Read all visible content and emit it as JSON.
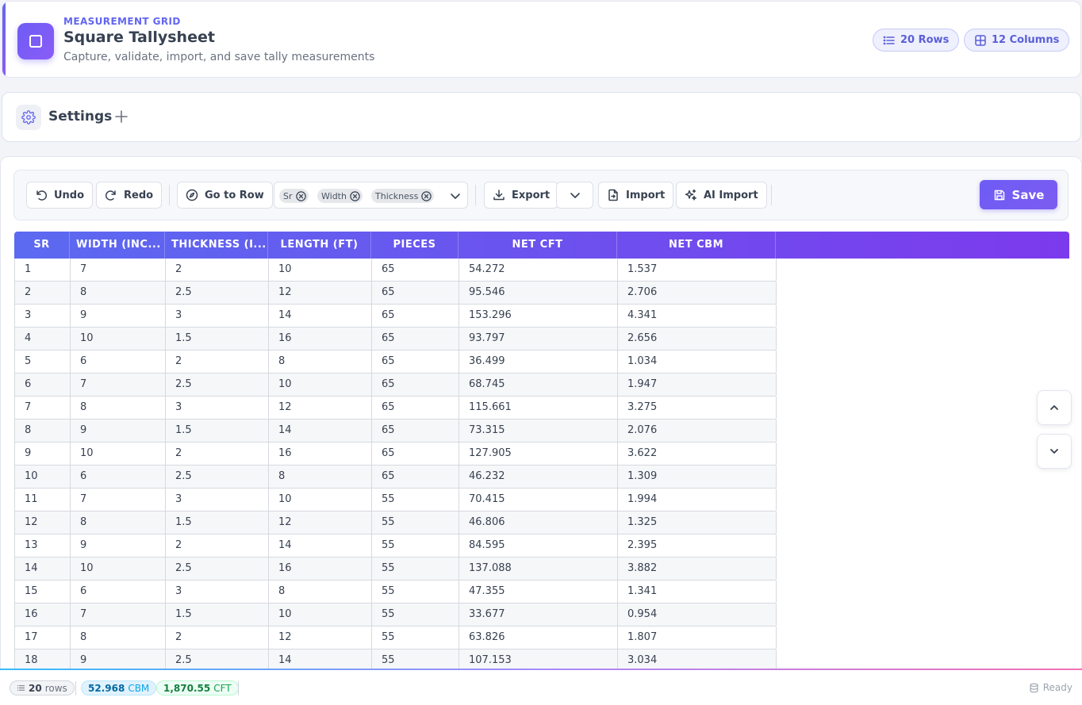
{
  "header": {
    "eyebrow": "MEASUREMENT GRID",
    "title": "Square Tallysheet",
    "subtitle": "Capture, validate, import, and save tally measurements",
    "rows_chip": "20 Rows",
    "columns_chip": "12 Columns",
    "accent_color": "#6366f1"
  },
  "settings": {
    "label": "Settings"
  },
  "toolbar": {
    "undo": "Undo",
    "redo": "Redo",
    "go_to_row": "Go to Row",
    "column_tags": [
      "Sr",
      "Width",
      "Thickness"
    ],
    "export": "Export",
    "import": "Import",
    "ai_import": "AI Import",
    "save": "Save"
  },
  "table": {
    "columns": [
      "SR",
      "WIDTH (INC...",
      "THICKNESS (I...",
      "LENGTH (FT)",
      "PIECES",
      "NET CFT",
      "NET CBM"
    ],
    "rows": [
      [
        "1",
        "7",
        "2",
        "10",
        "65",
        "54.272",
        "1.537"
      ],
      [
        "2",
        "8",
        "2.5",
        "12",
        "65",
        "95.546",
        "2.706"
      ],
      [
        "3",
        "9",
        "3",
        "14",
        "65",
        "153.296",
        "4.341"
      ],
      [
        "4",
        "10",
        "1.5",
        "16",
        "65",
        "93.797",
        "2.656"
      ],
      [
        "5",
        "6",
        "2",
        "8",
        "65",
        "36.499",
        "1.034"
      ],
      [
        "6",
        "7",
        "2.5",
        "10",
        "65",
        "68.745",
        "1.947"
      ],
      [
        "7",
        "8",
        "3",
        "12",
        "65",
        "115.661",
        "3.275"
      ],
      [
        "8",
        "9",
        "1.5",
        "14",
        "65",
        "73.315",
        "2.076"
      ],
      [
        "9",
        "10",
        "2",
        "16",
        "65",
        "127.905",
        "3.622"
      ],
      [
        "10",
        "6",
        "2.5",
        "8",
        "65",
        "46.232",
        "1.309"
      ],
      [
        "11",
        "7",
        "3",
        "10",
        "55",
        "70.415",
        "1.994"
      ],
      [
        "12",
        "8",
        "1.5",
        "12",
        "55",
        "46.806",
        "1.325"
      ],
      [
        "13",
        "9",
        "2",
        "14",
        "55",
        "84.595",
        "2.395"
      ],
      [
        "14",
        "10",
        "2.5",
        "16",
        "55",
        "137.088",
        "3.882"
      ],
      [
        "15",
        "6",
        "3",
        "8",
        "55",
        "47.355",
        "1.341"
      ],
      [
        "16",
        "7",
        "1.5",
        "10",
        "55",
        "33.677",
        "0.954"
      ],
      [
        "17",
        "8",
        "2",
        "12",
        "55",
        "63.826",
        "1.807"
      ],
      [
        "18",
        "9",
        "2.5",
        "14",
        "55",
        "107.153",
        "3.034"
      ]
    ]
  },
  "status": {
    "rows_value": "20",
    "rows_unit": "rows",
    "cbm_value": "52.968",
    "cbm_unit": "CBM",
    "cft_value": "1,870.55",
    "cft_unit": "CFT",
    "state": "Ready"
  }
}
